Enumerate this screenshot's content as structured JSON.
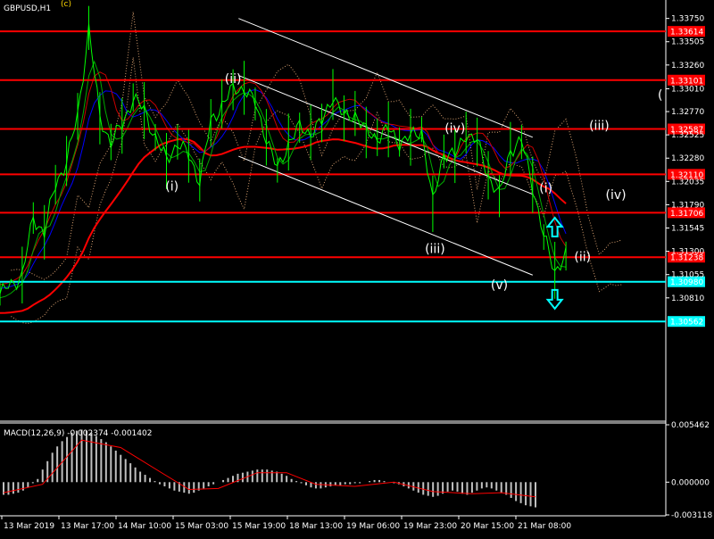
{
  "symbol_label": "GBPUSD,H1",
  "title_marker": "(c)",
  "colors": {
    "background": "#000000",
    "price": "#00ff00",
    "level_red": "#ff0000",
    "level_cyan": "#00ffff",
    "channel": "#ffffff",
    "ma_red": "#ff0000",
    "ma_blue": "#0000ff",
    "ma_green": "#00aa00",
    "ma_dark_red": "#cc0000",
    "cloud": "#d8a070",
    "macd_hist": "#c0c0c0",
    "macd_signal": "#ff0000",
    "label_bg_red": "#ff0000",
    "label_bg_cyan": "#00ffff"
  },
  "chart_data": [
    {
      "type": "line",
      "title": "GBPUSD,H1",
      "ylim": [
        1.2955,
        1.3385
      ],
      "y_ticks": [
        "1.33750",
        "1.33505",
        "1.33260",
        "1.33010",
        "1.32770",
        "1.32525",
        "1.32280",
        "1.32035",
        "1.31790",
        "1.31545",
        "1.31300",
        "1.31055",
        "1.30810"
      ],
      "x_tick_labels": [
        "13 Mar 2019",
        "13 Mar 17:00",
        "14 Mar 10:00",
        "15 Mar 03:00",
        "15 Mar 19:00",
        "18 Mar 13:00",
        "19 Mar 06:00",
        "19 Mar 23:00",
        "20 Mar 15:00",
        "21 Mar 08:00"
      ],
      "price_path": [
        [
          0,
          1.3085
        ],
        [
          2,
          1.3105
        ],
        [
          3,
          1.3165
        ],
        [
          4,
          1.315
        ],
        [
          5,
          1.32
        ],
        [
          6,
          1.3225
        ],
        [
          7,
          1.3272
        ],
        [
          8,
          1.3365
        ],
        [
          9,
          1.327
        ],
        [
          10,
          1.3245
        ],
        [
          11,
          1.3262
        ],
        [
          12,
          1.3292
        ],
        [
          13,
          1.3278
        ],
        [
          14,
          1.325
        ],
        [
          15,
          1.3225
        ],
        [
          16,
          1.3245
        ],
        [
          17,
          1.323
        ],
        [
          18,
          1.3205
        ],
        [
          19,
          1.3265
        ],
        [
          20,
          1.3285
        ],
        [
          21,
          1.33
        ],
        [
          22,
          1.3302
        ],
        [
          23,
          1.3285
        ],
        [
          24,
          1.325
        ],
        [
          25,
          1.3215
        ],
        [
          26,
          1.3245
        ],
        [
          27,
          1.326
        ],
        [
          28,
          1.3255
        ],
        [
          29,
          1.3265
        ],
        [
          30,
          1.3295
        ],
        [
          31,
          1.327
        ],
        [
          32,
          1.3275
        ],
        [
          33,
          1.3255
        ],
        [
          34,
          1.325
        ],
        [
          35,
          1.3258
        ],
        [
          36,
          1.3245
        ],
        [
          37,
          1.325
        ],
        [
          38,
          1.3258
        ],
        [
          39,
          1.318
        ],
        [
          40,
          1.3235
        ],
        [
          41,
          1.323
        ],
        [
          42,
          1.3255
        ],
        [
          43,
          1.3245
        ],
        [
          44,
          1.321
        ],
        [
          45,
          1.3188
        ],
        [
          46,
          1.3238
        ],
        [
          47,
          1.3245
        ],
        [
          48,
          1.32
        ],
        [
          49,
          1.3145
        ],
        [
          50,
          1.311
        ],
        [
          51,
          1.3125
        ]
      ],
      "levels": [
        {
          "label": "1.33614",
          "value": 1.33614,
          "color": "red"
        },
        {
          "label": "1.33101",
          "value": 1.33101,
          "color": "red"
        },
        {
          "label": "1.32587",
          "value": 1.32587,
          "color": "red"
        },
        {
          "label": "1.32110",
          "value": 1.3211,
          "color": "red"
        },
        {
          "label": "1.31706",
          "value": 1.31706,
          "color": "red"
        },
        {
          "label": "1.31238",
          "value": 1.31238,
          "color": "red"
        },
        {
          "label": "1.30980",
          "value": 1.3098,
          "color": "cyan"
        },
        {
          "label": "1.30562",
          "value": 1.30562,
          "color": "cyan"
        }
      ],
      "wave_labels": [
        {
          "text": "(ii)",
          "x": 21.0,
          "y": 1.3307
        },
        {
          "text": "(i)",
          "x": 15.5,
          "y": 1.3194
        },
        {
          "text": "(iii)",
          "x": 39.2,
          "y": 1.3128
        },
        {
          "text": "(iv)",
          "x": 41.0,
          "y": 1.3255
        },
        {
          "text": "(v)",
          "x": 45.0,
          "y": 1.309
        },
        {
          "text": "(i)",
          "x": 49.2,
          "y": 1.3192
        },
        {
          "text": "(ii)",
          "x": 52.5,
          "y": 1.312
        },
        {
          "text": "(iii)",
          "x": 54.0,
          "y": 1.3258
        },
        {
          "text": "(iv)",
          "x": 55.5,
          "y": 1.3185
        }
      ],
      "edge_label": "(",
      "arrows": [
        {
          "direction": "up",
          "x": 50.0,
          "y": 1.3155
        },
        {
          "direction": "down",
          "x": 50.0,
          "y": 1.308
        }
      ],
      "channel_lines": [
        [
          [
            21.5,
            1.3375
          ],
          [
            48.0,
            1.325
          ]
        ],
        [
          [
            21.5,
            1.3315
          ],
          [
            48.0,
            1.319
          ]
        ],
        [
          [
            21.5,
            1.323
          ],
          [
            48.0,
            1.3105
          ]
        ]
      ]
    },
    {
      "type": "bar",
      "title": "MACD(12,26,9) -0.002374 -0.001402",
      "ylim": [
        -0.003118,
        0.005462
      ],
      "y_ticks": [
        "0.005462",
        "0.000000",
        "-0.003118"
      ],
      "histogram": [
        -0.0012,
        -0.0012,
        -0.0011,
        -0.001,
        -0.0008,
        -0.0005,
        -0.0001,
        0.0003,
        0.0012,
        0.002,
        0.0028,
        0.0034,
        0.0039,
        0.0043,
        0.0047,
        0.0049,
        0.005,
        0.0049,
        0.0047,
        0.0044,
        0.0041,
        0.0038,
        0.0034,
        0.003,
        0.0026,
        0.0022,
        0.0018,
        0.0014,
        0.001,
        0.0007,
        0.0004,
        0.0001,
        -0.0002,
        -0.0004,
        -0.0006,
        -0.0008,
        -0.0009,
        -0.001,
        -0.0011,
        -0.001,
        -0.0008,
        -0.0006,
        -0.0004,
        -0.0002,
        0.0,
        0.0002,
        0.0004,
        0.0006,
        0.0008,
        0.0009,
        0.001,
        0.0011,
        0.0012,
        0.0012,
        0.0012,
        0.0011,
        0.001,
        0.0008,
        0.0006,
        0.0003,
        0.0001,
        -0.0001,
        -0.0003,
        -0.0005,
        -0.0006,
        -0.0006,
        -0.0005,
        -0.0004,
        -0.0003,
        -0.0003,
        -0.0002,
        -0.0002,
        -0.0001,
        -0.0001,
        0.0,
        0.0001,
        0.0002,
        0.0002,
        0.0001,
        0.0,
        -0.0001,
        -0.0002,
        -0.0004,
        -0.0006,
        -0.0008,
        -0.001,
        -0.0012,
        -0.0013,
        -0.0014,
        -0.0013,
        -0.0011,
        -0.0009,
        -0.0008,
        -0.0009,
        -0.0011,
        -0.0012,
        -0.001,
        -0.0008,
        -0.0006,
        -0.0005,
        -0.0006,
        -0.0008,
        -0.001,
        -0.0012,
        -0.0015,
        -0.0018,
        -0.002,
        -0.0022,
        -0.0023,
        -0.0024
      ],
      "signal": [
        [
          0,
          -0.001
        ],
        [
          8,
          -0.0002
        ],
        [
          16,
          0.004
        ],
        [
          24,
          0.0033
        ],
        [
          32,
          0.001
        ],
        [
          38,
          -0.0007
        ],
        [
          44,
          -0.0006
        ],
        [
          52,
          0.0009
        ],
        [
          58,
          0.0009
        ],
        [
          64,
          -0.0002
        ],
        [
          72,
          -0.0004
        ],
        [
          80,
          0.0
        ],
        [
          88,
          -0.0009
        ],
        [
          96,
          -0.0011
        ],
        [
          102,
          -0.001
        ],
        [
          109,
          -0.0014
        ]
      ]
    }
  ]
}
